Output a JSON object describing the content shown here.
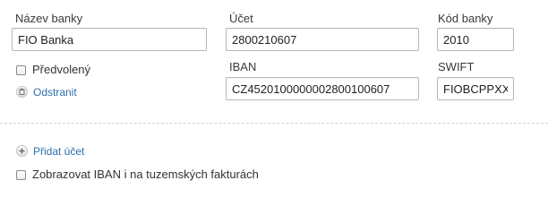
{
  "bank_form": {
    "bank_name": {
      "label": "Název banky",
      "value": "FIO Banka"
    },
    "account": {
      "label": "Účet",
      "value": "2800210607"
    },
    "bank_code": {
      "label": "Kód banky",
      "value": "2010"
    },
    "iban": {
      "label": "IBAN",
      "value": "CZ4520100000002800100607"
    },
    "swift": {
      "label": "SWIFT",
      "value": "FIOBCPPXXX"
    },
    "default_checkbox": {
      "label": "Předvolený",
      "checked": false
    },
    "remove_link": "Odstranit"
  },
  "actions": {
    "add_account": "Přidat účet"
  },
  "options": {
    "show_iban": {
      "label": "Zobrazovat IBAN i na tuzemských fakturách",
      "checked": false
    }
  },
  "icons": {
    "remove": "trash-icon",
    "add": "plus-icon"
  },
  "colors": {
    "link": "#2f6fa8",
    "input_border": "#b8b8b8"
  }
}
